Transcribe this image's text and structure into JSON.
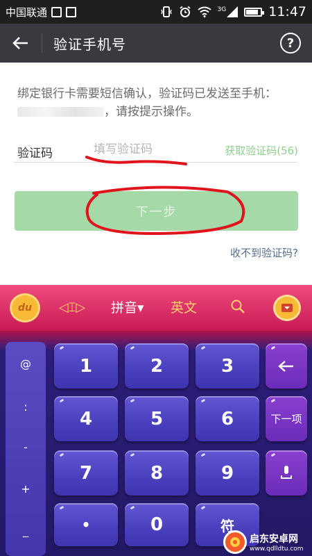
{
  "status_bar": {
    "carrier": "中国联通",
    "network": "3G",
    "time": "11:47",
    "battery_level": 0.85
  },
  "header": {
    "title": "验证手机号",
    "back_icon": "arrow-left-icon",
    "help_label": "?"
  },
  "form": {
    "info_prefix": "绑定银行卡需要短信确认，验证码已发送至手机：",
    "info_suffix": "，请按提示操作。",
    "code_label": "验证码",
    "code_placeholder": "填写验证码",
    "get_code_label": "获取验证码(56)",
    "next_label": "下一步",
    "no_code_label": "收不到验证码?"
  },
  "keyboard": {
    "logo_text": "du",
    "pinyin_label": "拼音▾",
    "english_label": "英文",
    "side_keys": [
      "@",
      ":",
      "-",
      "+",
      "_"
    ],
    "digits": [
      "1",
      "2",
      "3",
      "4",
      "5",
      "6",
      "7",
      "8",
      "9",
      "0"
    ],
    "dot_label": "•",
    "next_item_label": "下一项",
    "symbol_label": "符"
  },
  "watermark": {
    "name": "启东安卓网",
    "url": "www.qdlldtu.com"
  },
  "colors": {
    "header_bg": "#393a3f",
    "button_green": "#a6d9a8",
    "link_blue": "#546e8f",
    "annotation_red": "#e0141d",
    "keyboard_key": "#4a3fbd"
  }
}
